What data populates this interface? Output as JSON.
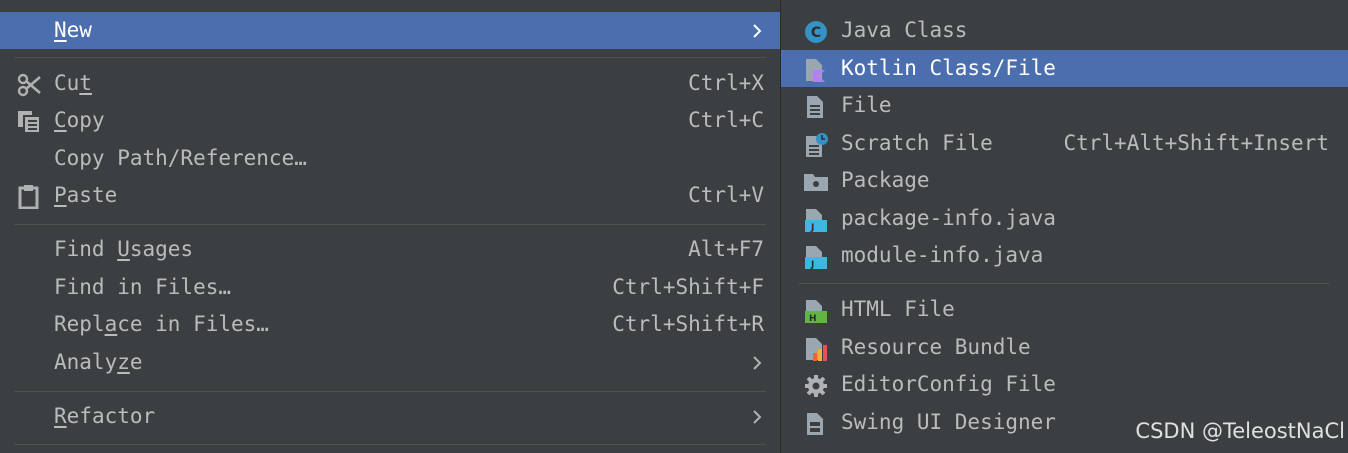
{
  "main_menu": {
    "new": {
      "pre": "",
      "u": "N",
      "post": "ew"
    },
    "cut": {
      "pre": "Cu",
      "u": "t",
      "post": "",
      "shortcut": "Ctrl+X"
    },
    "copy": {
      "pre": "",
      "u": "C",
      "post": "opy",
      "shortcut": "Ctrl+C"
    },
    "copy_path": {
      "label": "Copy Path/Reference…"
    },
    "paste": {
      "pre": "",
      "u": "P",
      "post": "aste",
      "shortcut": "Ctrl+V"
    },
    "find_usages": {
      "pre": "Find ",
      "u": "U",
      "post": "sages",
      "shortcut": "Alt+F7"
    },
    "find_in_files": {
      "label": "Find in Files…",
      "shortcut": "Ctrl+Shift+F"
    },
    "replace_in_files": {
      "pre": "Repl",
      "u": "a",
      "post": "ce in Files…",
      "shortcut": "Ctrl+Shift+R"
    },
    "analyze": {
      "pre": "Analy",
      "u": "z",
      "post": "e"
    },
    "refactor": {
      "pre": "",
      "u": "R",
      "post": "efactor"
    }
  },
  "new_submenu": {
    "items": [
      {
        "label": "Java Class",
        "icon": "java-class-icon"
      },
      {
        "label": "Kotlin Class/File",
        "icon": "kotlin-file-icon"
      },
      {
        "label": "File",
        "icon": "file-icon"
      },
      {
        "label": "Scratch File",
        "icon": "scratch-file-icon",
        "shortcut": "Ctrl+Alt+Shift+Insert"
      },
      {
        "label": "Package",
        "icon": "package-folder-icon"
      },
      {
        "label": "package-info.java",
        "icon": "java-file-icon"
      },
      {
        "label": "module-info.java",
        "icon": "java-file-icon"
      },
      {
        "label": "HTML File",
        "icon": "html-file-icon"
      },
      {
        "label": "Resource Bundle",
        "icon": "resource-bundle-icon"
      },
      {
        "label": "EditorConfig File",
        "icon": "gear-icon"
      },
      {
        "label": "Swing UI Designer",
        "icon": "ui-form-icon"
      }
    ]
  },
  "watermark": "CSDN @TeleostNaCl",
  "colors": {
    "background": "#3c3f41",
    "selection": "#4b6eaf",
    "text": "#bbbbbb",
    "separator": "#515151"
  }
}
